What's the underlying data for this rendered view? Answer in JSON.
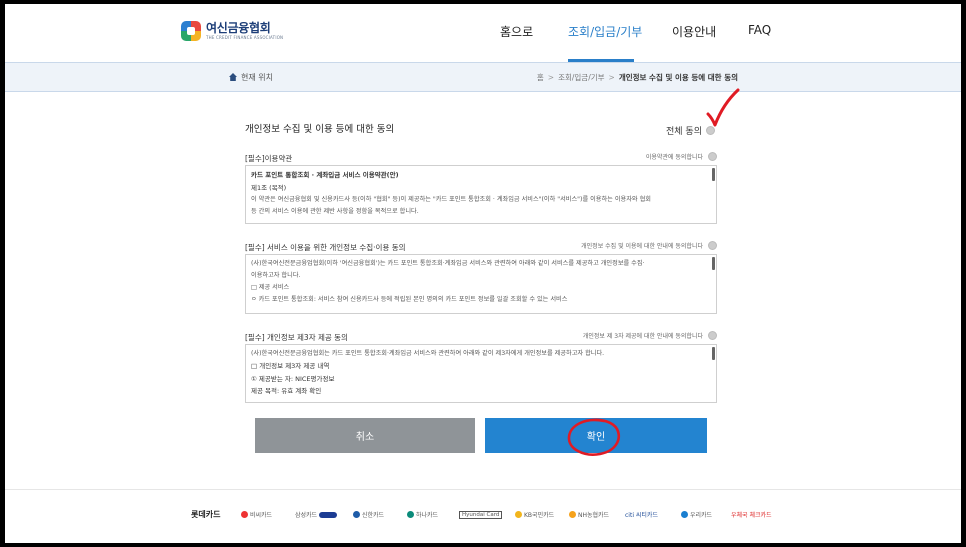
{
  "header": {
    "logo_ko": "여신금융협회",
    "logo_en": "THE CREDIT FINANCE ASSOCIATION",
    "nav": [
      "홈으로",
      "조회/입금/기부",
      "이용안내",
      "FAQ"
    ]
  },
  "location": {
    "label": "현재 위치",
    "breadcrumb": [
      "홈",
      "조회/입금/기부",
      "개인정보 수집 및 이용 등에 대한 동의"
    ]
  },
  "main": {
    "title": "개인정보 수집 및 이용 등에 대한 동의",
    "all_agree": "전체 동의",
    "sections": [
      {
        "heading": "[필수]이용약관",
        "agree_label": "이용약관에 동의합니다",
        "lines": [
          "카드 포인트 통합조회 · 계좌입금 서비스 이용약관(안)",
          "제1조 (목적)",
          "이 약관은 여신금융협회 및 신용카드사 등(이하 \"협회\" 등)이 제공하는 \"카드 포인트 통합조회 · 계좌입금 서비스\"(이하 \"서비스\")를 이용하는 이용자와 협회",
          "등 간의 서비스 이용에 관한 제반 사항을 정함을 목적으로 합니다."
        ]
      },
      {
        "heading": "[필수] 서비스 이용을 위한 개인정보 수집·이용 동의",
        "agree_label": "개인정보 수집 및 이용에 대한 안내에 동의합니다",
        "lines": [
          "(사)한국여신전문금융업협회(이하 '여신금융협회')는 카드 포인트 통합조회·계좌입금 서비스와 관련하여 아래와 같이 서비스를 제공하고 개인정보를 수집·",
          "이용하고자 합니다.",
          "□ 제공 서비스",
          "ㅇ 카드 포인트 통합조회: 서비스 참여 신용카드사 등에 적립된 본인 명의의 카드 포인트 정보를 일괄 조회할 수 있는 서비스"
        ]
      },
      {
        "heading": "[필수] 개인정보 제3자 제공 동의",
        "agree_label": "개인정보 제 3자 제공에 대한 안내에 동의합니다",
        "lines": [
          "(사)한국여신전문금융업협회는 카드 포인트 통합조회·계좌입금 서비스와 관련하여 아래와 같이 제3자에게 개인정보를 제공하고자 합니다.",
          "□ 개인정보 제3자 제공 내역",
          "① 제공받는 자: NICE평가정보",
          "제공 목적: 유효 계좌 확인"
        ]
      }
    ],
    "cancel_label": "취소",
    "confirm_label": "확인"
  },
  "footer": {
    "card_companies": [
      "롯데카드",
      "비씨카드",
      "삼성카드",
      "신한카드",
      "하나카드",
      "Hyundai Card",
      "KB국민카드",
      "NH농협카드",
      "citi 씨티카드",
      "우리카드",
      "우체국 체크카드"
    ]
  },
  "colors": {
    "accent": "#2384d0",
    "nav_active": "#2a7fc9",
    "cancel": "#8f9498",
    "annotation": "#e01b24"
  }
}
